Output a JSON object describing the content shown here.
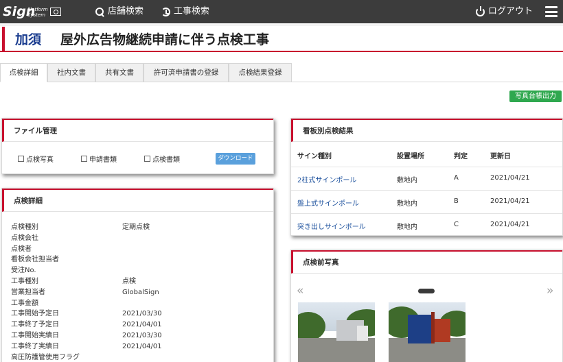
{
  "header": {
    "logo_main": "Sign",
    "logo_sub_1": "Platform",
    "logo_sub_2": "System",
    "store_search": "店舗検索",
    "work_search": "工事検索",
    "logout": "ログアウト"
  },
  "page": {
    "prefecture": "加須",
    "title": "屋外広告物継続申請に伴う点検工事"
  },
  "tabs": [
    "点検詳細",
    "社内文書",
    "共有文書",
    "許可済申請書の登録",
    "点検結果登録"
  ],
  "actions": {
    "photo_ledger": "写真台帳出力"
  },
  "file_panel": {
    "title": "ファイル管理",
    "checkboxes": [
      "点検写真",
      "申請書類",
      "点検書類"
    ],
    "download": "ダウンロード"
  },
  "detail_panel": {
    "title": "点検詳細",
    "rows": [
      {
        "label": "点検種別",
        "value": "定期点検"
      },
      {
        "label": "点検会社",
        "value": ""
      },
      {
        "label": "点検者",
        "value": ""
      },
      {
        "label": "看板会社担当者",
        "value": ""
      },
      {
        "label": "受注No.",
        "value": ""
      },
      {
        "label": "工事種別",
        "value": "点検"
      },
      {
        "label": "営業担当者",
        "value": "GlobalSign"
      },
      {
        "label": "工事金額",
        "value": ""
      },
      {
        "label": "工事開始予定日",
        "value": "2021/03/30"
      },
      {
        "label": "工事終了予定日",
        "value": "2021/04/01"
      },
      {
        "label": "工事開始実績日",
        "value": "2021/03/30"
      },
      {
        "label": "工事終了実績日",
        "value": "2021/04/01"
      },
      {
        "label": "高圧防護管使用フラグ",
        "value": ""
      }
    ]
  },
  "results_panel": {
    "title": "看板別点検結果",
    "headers": [
      "サイン種別",
      "設置場所",
      "判定",
      "更新日"
    ],
    "rows": [
      {
        "sign": "2柱式サインポール",
        "location": "敷地内",
        "judgement": "A",
        "date": "2021/04/21"
      },
      {
        "sign": "盤上式サインポール",
        "location": "敷地内",
        "judgement": "B",
        "date": "2021/04/21"
      },
      {
        "sign": "突き出しサインポール",
        "location": "敷地内",
        "judgement": "C",
        "date": "2021/04/21"
      }
    ]
  },
  "photos_panel": {
    "title": "点検前写真",
    "prev": "«",
    "next": "»"
  },
  "colors": {
    "accent": "#c8102e",
    "brand_blue": "#1a3c8f",
    "topbar": "#3c3c3c",
    "green": "#2fa84f",
    "download_blue": "#5aa0dc"
  }
}
